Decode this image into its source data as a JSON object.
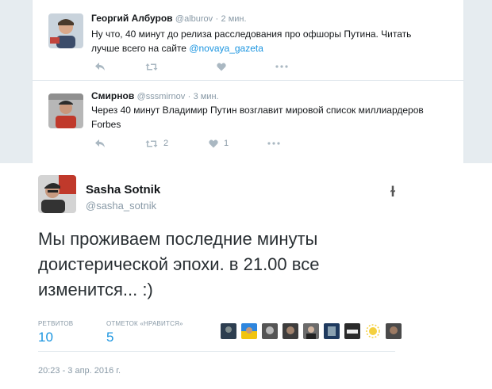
{
  "feed": {
    "tweets": [
      {
        "name": "Георгий Албуров",
        "handle": "@alburov",
        "time": "2 мин.",
        "text": "Ну что, 40 минут до релиза расследования про офшоры Путина. Читать лучше всего на сайте ",
        "link": "@novaya_gazeta",
        "retweets": "",
        "likes": ""
      },
      {
        "name": "Смирнов",
        "handle": "@sssmirnov",
        "time": "3 мин.",
        "text": "Через 40 минут Владимир Путин возглавит мировой список миллиардеров Forbes",
        "link": "",
        "retweets": "2",
        "likes": "1"
      }
    ]
  },
  "main_tweet": {
    "name": "Sasha Sotnik",
    "handle": "@sasha_sotnik",
    "text": "Мы проживаем последние минуты доистерической эпохи. в 21.00 все изменится... :)",
    "retweets_label": "РЕТВИТОВ",
    "retweets": "10",
    "likes_label": "ОТМЕТОК «НРАВИТСЯ»",
    "likes": "5",
    "timestamp": "20:23 - 3 апр. 2016 г.",
    "follow_glyph": "ɫ"
  },
  "colors": {
    "link": "#1b95e0",
    "muted": "#8899a6",
    "icon": "#aab8c2",
    "background": "#e6ecf0"
  },
  "icons": [
    "reply-icon",
    "retweet-icon",
    "like-icon",
    "more-icon"
  ]
}
